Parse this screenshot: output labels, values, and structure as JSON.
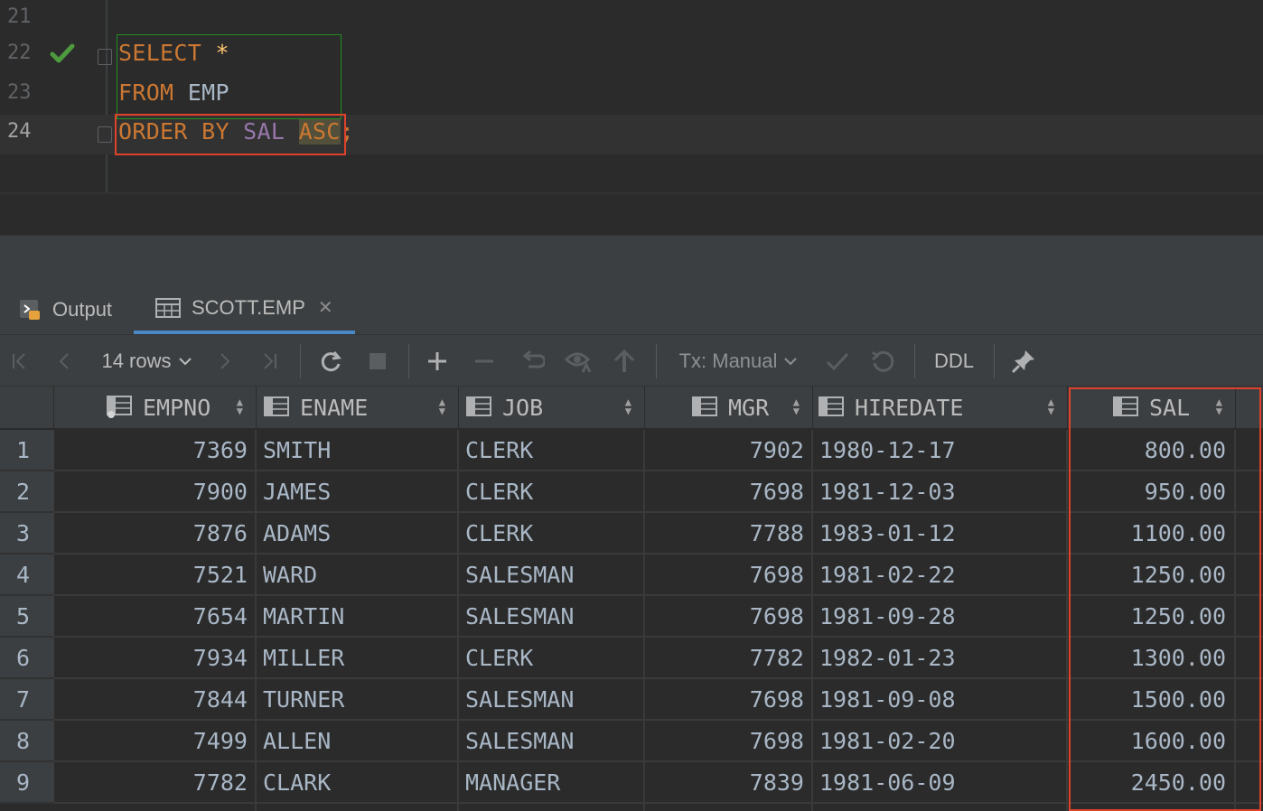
{
  "editor": {
    "lines": [
      {
        "number": "21"
      },
      {
        "number": "22"
      },
      {
        "number": "23"
      },
      {
        "number": "24"
      }
    ],
    "sql": {
      "select_kw": "SELECT",
      "star": "*",
      "from_kw": "FROM",
      "table": "EMP",
      "order_kw": "ORDER BY",
      "column": "SAL",
      "direction": "ASC",
      "terminator": ";"
    }
  },
  "tabs": [
    {
      "label": "Output",
      "icon": "output-console-icon"
    },
    {
      "label": "SCOTT.EMP",
      "icon": "table-icon",
      "active": true
    }
  ],
  "toolbar": {
    "rows_label": "14 rows",
    "tx_label": "Tx: Manual",
    "ddl_label": "DDL",
    "icons": [
      "first-page-icon",
      "prev-page-icon",
      "next-page-icon",
      "last-page-icon",
      "reload-icon",
      "stop-icon",
      "add-row-icon",
      "delete-row-icon",
      "revert-icon",
      "preview-changes-icon",
      "submit-icon",
      "commit-icon",
      "rollback-icon",
      "pin-icon"
    ]
  },
  "grid": {
    "columns": [
      "EMPNO",
      "ENAME",
      "JOB",
      "MGR",
      "HIREDATE",
      "SAL"
    ],
    "rows": [
      {
        "n": "1",
        "EMPNO": "7369",
        "ENAME": "SMITH",
        "JOB": "CLERK",
        "MGR": "7902",
        "HIREDATE": "1980-12-17",
        "SAL": "800.00"
      },
      {
        "n": "2",
        "EMPNO": "7900",
        "ENAME": "JAMES",
        "JOB": "CLERK",
        "MGR": "7698",
        "HIREDATE": "1981-12-03",
        "SAL": "950.00"
      },
      {
        "n": "3",
        "EMPNO": "7876",
        "ENAME": "ADAMS",
        "JOB": "CLERK",
        "MGR": "7788",
        "HIREDATE": "1983-01-12",
        "SAL": "1100.00"
      },
      {
        "n": "4",
        "EMPNO": "7521",
        "ENAME": "WARD",
        "JOB": "SALESMAN",
        "MGR": "7698",
        "HIREDATE": "1981-02-22",
        "SAL": "1250.00"
      },
      {
        "n": "5",
        "EMPNO": "7654",
        "ENAME": "MARTIN",
        "JOB": "SALESMAN",
        "MGR": "7698",
        "HIREDATE": "1981-09-28",
        "SAL": "1250.00"
      },
      {
        "n": "6",
        "EMPNO": "7934",
        "ENAME": "MILLER",
        "JOB": "CLERK",
        "MGR": "7782",
        "HIREDATE": "1982-01-23",
        "SAL": "1300.00"
      },
      {
        "n": "7",
        "EMPNO": "7844",
        "ENAME": "TURNER",
        "JOB": "SALESMAN",
        "MGR": "7698",
        "HIREDATE": "1981-09-08",
        "SAL": "1500.00"
      },
      {
        "n": "8",
        "EMPNO": "7499",
        "ENAME": "ALLEN",
        "JOB": "SALESMAN",
        "MGR": "7698",
        "HIREDATE": "1981-02-20",
        "SAL": "1600.00"
      },
      {
        "n": "9",
        "EMPNO": "7782",
        "ENAME": "CLARK",
        "JOB": "MANAGER",
        "MGR": "7839",
        "HIREDATE": "1981-06-09",
        "SAL": "2450.00"
      }
    ]
  },
  "colors": {
    "keyword": "#cc7832",
    "column": "#9876aa",
    "highlight_red": "#e0412b",
    "highlight_green": "#1f8f1f",
    "check_green": "#4e9a3e"
  }
}
